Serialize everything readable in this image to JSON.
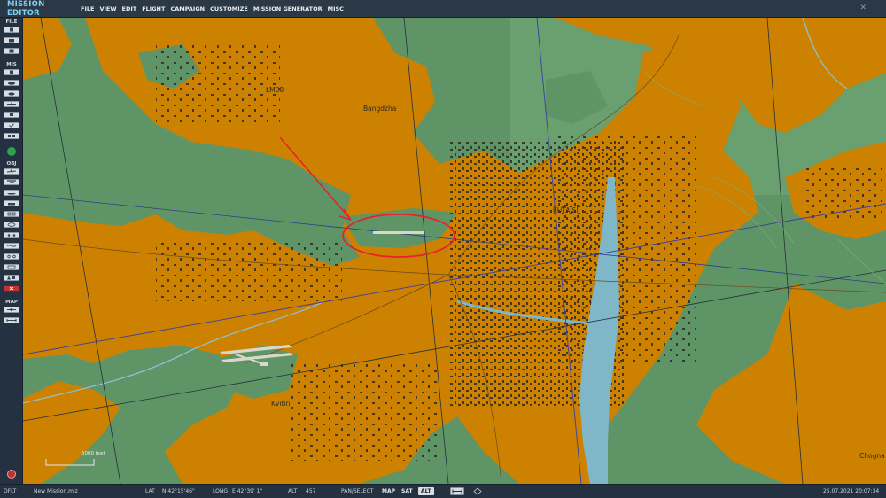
{
  "header": {
    "app_title": "MISSION EDITOR",
    "menu": [
      "FILE",
      "VIEW",
      "EDIT",
      "FLIGHT",
      "CAMPAIGN",
      "CUSTOMIZE",
      "MISSION GENERATOR",
      "MISC"
    ],
    "close_glyph": "✕"
  },
  "sidebar": {
    "sections": {
      "file": "FILE",
      "mis": "MIS",
      "obj": "OBJ",
      "map": "MAP"
    }
  },
  "map": {
    "labels": {
      "lm08": "LM08",
      "bangdzha": "Bangdzha",
      "kutaisi": "KUTAISI",
      "kvitiri": "Kvitiri",
      "chognari": "Chogna"
    },
    "scale_label": "5000 feet",
    "colors": {
      "urban": "#cc8200",
      "terrain": "#5f9566",
      "river": "#7fb6c8",
      "annotation": "#e8222a"
    }
  },
  "status": {
    "profile": "DFLT",
    "file": "New Mission.miz",
    "lat_label": "LAT",
    "lat_value": "N 42°15'46\"",
    "long_label": "LONG",
    "long_value": "E 42°39' 1\"",
    "alt_label": "ALT",
    "alt_value": "457",
    "mode_label": "PAN/SELECT",
    "map_modes": [
      "MAP",
      "SAT",
      "ALT"
    ],
    "active_mode": "ALT",
    "datetime": "25.07.2021 20:07:34"
  }
}
